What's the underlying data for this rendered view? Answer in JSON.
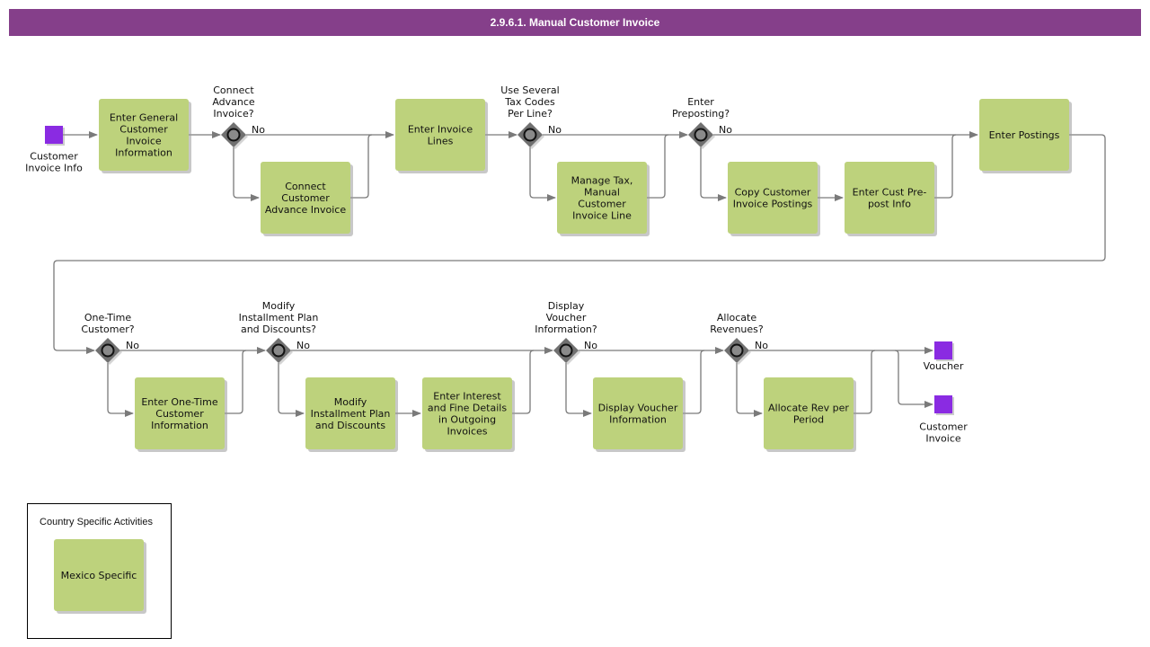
{
  "title": "2.9.6.1. Manual Customer Invoice",
  "colors": {
    "header": "#853f8a",
    "task": "#bdd27c",
    "event": "#8a2be2",
    "gateway": "#707070"
  },
  "events": {
    "start": {
      "label": [
        "Customer",
        "Invoice Info"
      ]
    },
    "end_voucher": {
      "label": [
        "Voucher"
      ]
    },
    "end_invoice": {
      "label": [
        "Customer",
        "Invoice"
      ]
    }
  },
  "tasks": {
    "enter_general": [
      "Enter General",
      "Customer",
      "Invoice",
      "Information"
    ],
    "connect_advance": [
      "Connect",
      "Customer",
      "Advance Invoice"
    ],
    "enter_lines": [
      "Enter Invoice",
      "Lines"
    ],
    "manage_tax": [
      "Manage Tax,",
      "Manual",
      "Customer",
      "Invoice Line"
    ],
    "copy_postings": [
      "Copy Customer",
      "Invoice Postings"
    ],
    "prepost_info": [
      "Enter Cust Pre-",
      "post Info"
    ],
    "enter_postings": [
      "Enter Postings"
    ],
    "one_time": [
      "Enter One-Time",
      "Customer",
      "Information"
    ],
    "installment": [
      "Modify",
      "Installment Plan",
      "and Discounts"
    ],
    "interest": [
      "Enter Interest",
      "and Fine Details",
      "in Outgoing",
      "Invoices"
    ],
    "display_voucher": [
      "Display Voucher",
      "Information"
    ],
    "allocate_rev": [
      "Allocate Rev per",
      "Period"
    ],
    "mexico": [
      "Mexico Specific"
    ]
  },
  "gateways": {
    "g1": {
      "question": [
        "Connect",
        "Advance",
        "Invoice?"
      ],
      "no": "No"
    },
    "g2": {
      "question": [
        "Use Several",
        "Tax Codes",
        "Per Line?"
      ],
      "no": "No"
    },
    "g3": {
      "question": [
        "Enter",
        "Preposting?"
      ],
      "no": "No"
    },
    "g4": {
      "question": [
        "One-Time",
        "Customer?"
      ],
      "no": "No"
    },
    "g5": {
      "question": [
        "Modify",
        "Installment Plan",
        "and Discounts?"
      ],
      "no": "No"
    },
    "g6": {
      "question": [
        "Display",
        "Voucher",
        "Information?"
      ],
      "no": "No"
    },
    "g7": {
      "question": [
        "Allocate",
        "Revenues?"
      ],
      "no": "No"
    }
  },
  "legend": {
    "title": "Country Specific Activities"
  }
}
